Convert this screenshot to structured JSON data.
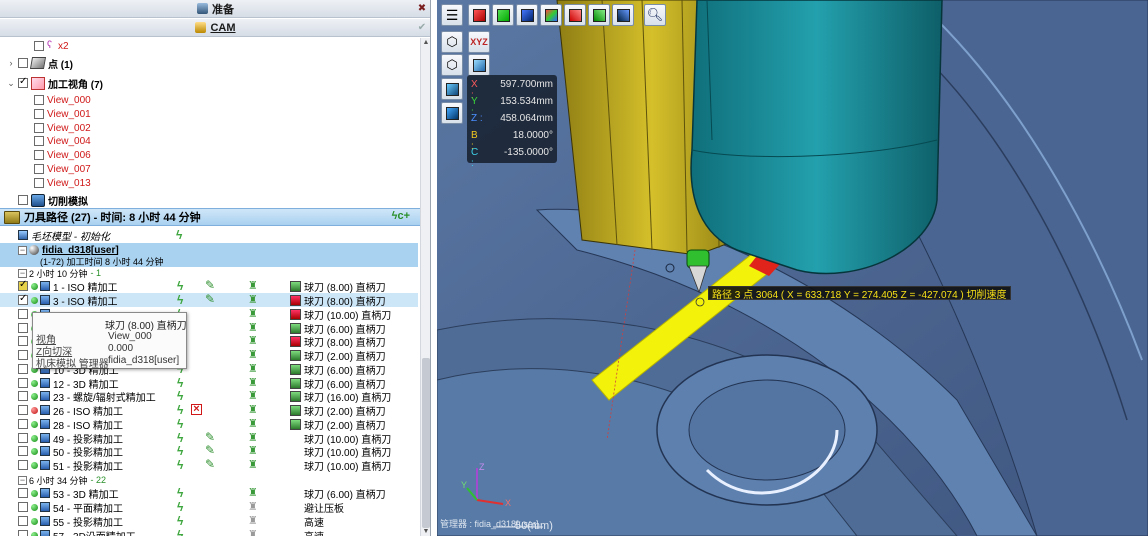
{
  "left": {
    "prep_title": "准备",
    "cam_title": "CAM",
    "close_glyph": "✖",
    "check_glyph": "✔",
    "tree": {
      "x2": "x2",
      "points": "点 (1)",
      "views_folder": "加工视角 (7)",
      "views": [
        "View_000",
        "View_001",
        "View_002",
        "View_004",
        "View_006",
        "View_007",
        "View_013"
      ],
      "cut_sim": "切削模拟"
    },
    "toolpaths_header": "刀具路径 (27) - 时间: 8 小时 44 分钟",
    "stock": "毛坯模型 - 初始化",
    "machine": {
      "name": "fidia_d318[user]",
      "sub": "(1-72) 加工时间 8 小时 44 分钟"
    },
    "group1": {
      "time": "2 小时 10 分钟",
      "count": "- 1"
    },
    "group2": {
      "time": "6 小时 34 分钟",
      "count": "- 22"
    },
    "ops": [
      {
        "label": "1 - ISO 精加工",
        "tool": "球刀 (8.00) 直柄刀"
      },
      {
        "label": "3 - ISO 精加工",
        "tool": "球刀 (8.00) 直柄刀"
      },
      {
        "label": "",
        "tool": "球刀 (10.00) 直柄刀"
      },
      {
        "label": "",
        "tool": "球刀 (6.00) 直柄刀"
      },
      {
        "label": "",
        "tool": "球刀 (8.00) 直柄刀"
      },
      {
        "label": "",
        "tool": "球刀 (2.00) 直柄刀"
      },
      {
        "label": "10 - 3D 精加工",
        "tool": "球刀 (6.00) 直柄刀"
      },
      {
        "label": "12 - 3D 精加工",
        "tool": "球刀 (6.00) 直柄刀"
      },
      {
        "label": "23 - 螺旋/辐射式精加工",
        "tool": "球刀 (16.00) 直柄刀"
      },
      {
        "label": "26 - ISO 精加工",
        "tool": "球刀 (2.00) 直柄刀"
      },
      {
        "label": "28 - ISO 精加工",
        "tool": "球刀 (2.00) 直柄刀"
      },
      {
        "label": "49 - 投影精加工",
        "tool": "球刀 (10.00) 直柄刀"
      },
      {
        "label": "50 - 投影精加工",
        "tool": "球刀 (10.00) 直柄刀"
      },
      {
        "label": "51 - 投影精加工",
        "tool": "球刀 (10.00) 直柄刀"
      },
      {
        "label": "53 - 3D 精加工",
        "tool": "球刀 (6.00) 直柄刀"
      },
      {
        "label": "54 - 平面精加工",
        "tool": "避让压板"
      },
      {
        "label": "55 - 投影精加工",
        "tool": "高速"
      },
      {
        "label": "57 - 3D沿面精加工",
        "tool": "高速"
      }
    ],
    "tooltip": {
      "title": "球刀 (8.00) 直柄刀",
      "rows": [
        {
          "k": "视角",
          "v": "View_000"
        },
        {
          "k": "Z向切深",
          "v": "0.000"
        },
        {
          "k": "机床模拟 管理器",
          "v": "fidia_d318[user]"
        }
      ]
    }
  },
  "viewport": {
    "coords": [
      {
        "k": "X :",
        "v": "597.700mm",
        "color": "#ff5a5a"
      },
      {
        "k": "Y :",
        "v": "153.534mm",
        "color": "#39d439"
      },
      {
        "k": "Z :",
        "v": "458.064mm",
        "color": "#4a8dff"
      },
      {
        "k": "B :",
        "v": "18.0000°",
        "color": "#f0c820"
      },
      {
        "k": "C :",
        "v": "-135.0000°",
        "color": "#3fd0e8"
      }
    ],
    "path_label": "路径 3 点 3064 ( X = 633.718  Y = 274.405  Z = -427.074 ) 切削速度",
    "status": "管理器 : fidia_d318[user]",
    "scale": "50(mm)",
    "axis_labels": {
      "x": "X",
      "y": "Y",
      "z": "Z"
    }
  },
  "colors": {
    "model_blue": "#4d6a95",
    "holder_teal": "#1d8c98",
    "spindle_yellow": "#c9b323",
    "toolpath_yellow": "#f2f20a"
  }
}
